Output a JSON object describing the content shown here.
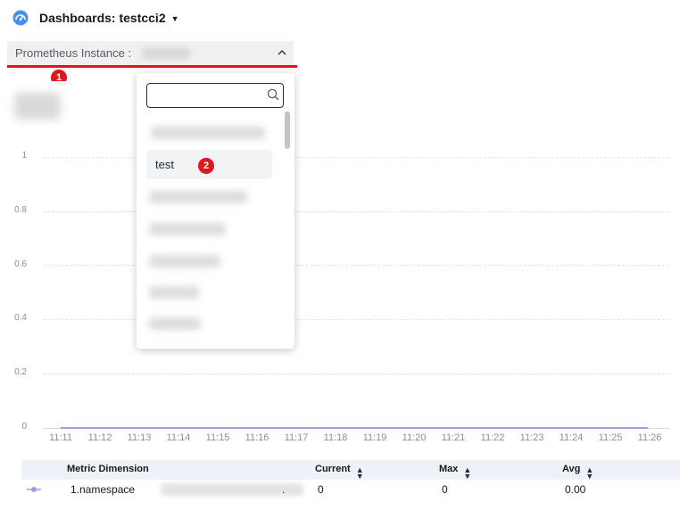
{
  "header": {
    "title": "Dashboards: testcci2",
    "dropdown_caret": "▼"
  },
  "instance_selector": {
    "label": "Prometheus Instance :",
    "chevron": "^"
  },
  "annotations": {
    "step1": "1",
    "step2": "2"
  },
  "dropdown": {
    "search_value": "",
    "options": [
      "test"
    ]
  },
  "chart_data": {
    "type": "line",
    "x": [
      "11:11",
      "11:12",
      "11:13",
      "11:14",
      "11:15",
      "11:16",
      "11:17",
      "11:18",
      "11:19",
      "11:20",
      "11:21",
      "11:22",
      "11:23",
      "11:24",
      "11:25",
      "11:26"
    ],
    "yticks": [
      "1",
      "0.8",
      "0.6",
      "0.4",
      "0.2",
      "0"
    ],
    "ylim": [
      0,
      1
    ],
    "grid": true,
    "series": [
      {
        "values": [
          0,
          0,
          0,
          0,
          0,
          0,
          0,
          0,
          0,
          0,
          0,
          0,
          0,
          0,
          0,
          0
        ],
        "color": "#b194e8"
      }
    ]
  },
  "table": {
    "headers": {
      "dimension": "Metric Dimension",
      "current": "Current",
      "max": "Max",
      "avg": "Avg"
    },
    "rows": [
      {
        "dimension_prefix": "1.namespace",
        "dimension_suffix": ".",
        "current": "0",
        "max": "0",
        "avg": "0.00"
      }
    ]
  },
  "colors": {
    "accent_red": "#e0161e",
    "series": "#b194e8",
    "brand_blue": "#2c7be5"
  }
}
